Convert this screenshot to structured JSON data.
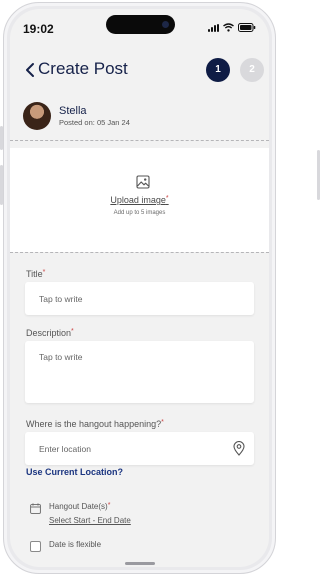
{
  "status_bar": {
    "time": "19:02",
    "icons": [
      "signal-icon",
      "wifi-icon",
      "battery-icon"
    ]
  },
  "header": {
    "title": "Create Post",
    "back_icon": "chevron-left-icon",
    "steps": [
      "1",
      "2"
    ],
    "active_step": 1
  },
  "author": {
    "name": "Stella",
    "posted_on": "Posted on: 05 Jan 24"
  },
  "upload": {
    "icon": "image-icon",
    "label": "Upload image",
    "required_mark": "*",
    "hint": "Add up to 5 images"
  },
  "title_field": {
    "label": "Title",
    "required_mark": "*",
    "placeholder": "Tap to write"
  },
  "description_field": {
    "label": "Description",
    "required_mark": "*",
    "placeholder": "Tap to write"
  },
  "location_field": {
    "label": "Where is the hangout happening?",
    "required_mark": "*",
    "placeholder": "Enter location",
    "icon": "location-pin-icon"
  },
  "use_current_location": "Use Current Location?",
  "hangout_date": {
    "icon": "calendar-icon",
    "label": "Hangout Date(s)",
    "required_mark": "*",
    "select_text": "Select Start - End Date"
  },
  "flexible_date": {
    "label": "Date is flexible",
    "checked": false
  },
  "colors": {
    "primary": "#0f1c45",
    "link": "#1b3580",
    "inactive_step": "#d9d9dc",
    "required": "#cc4444"
  }
}
